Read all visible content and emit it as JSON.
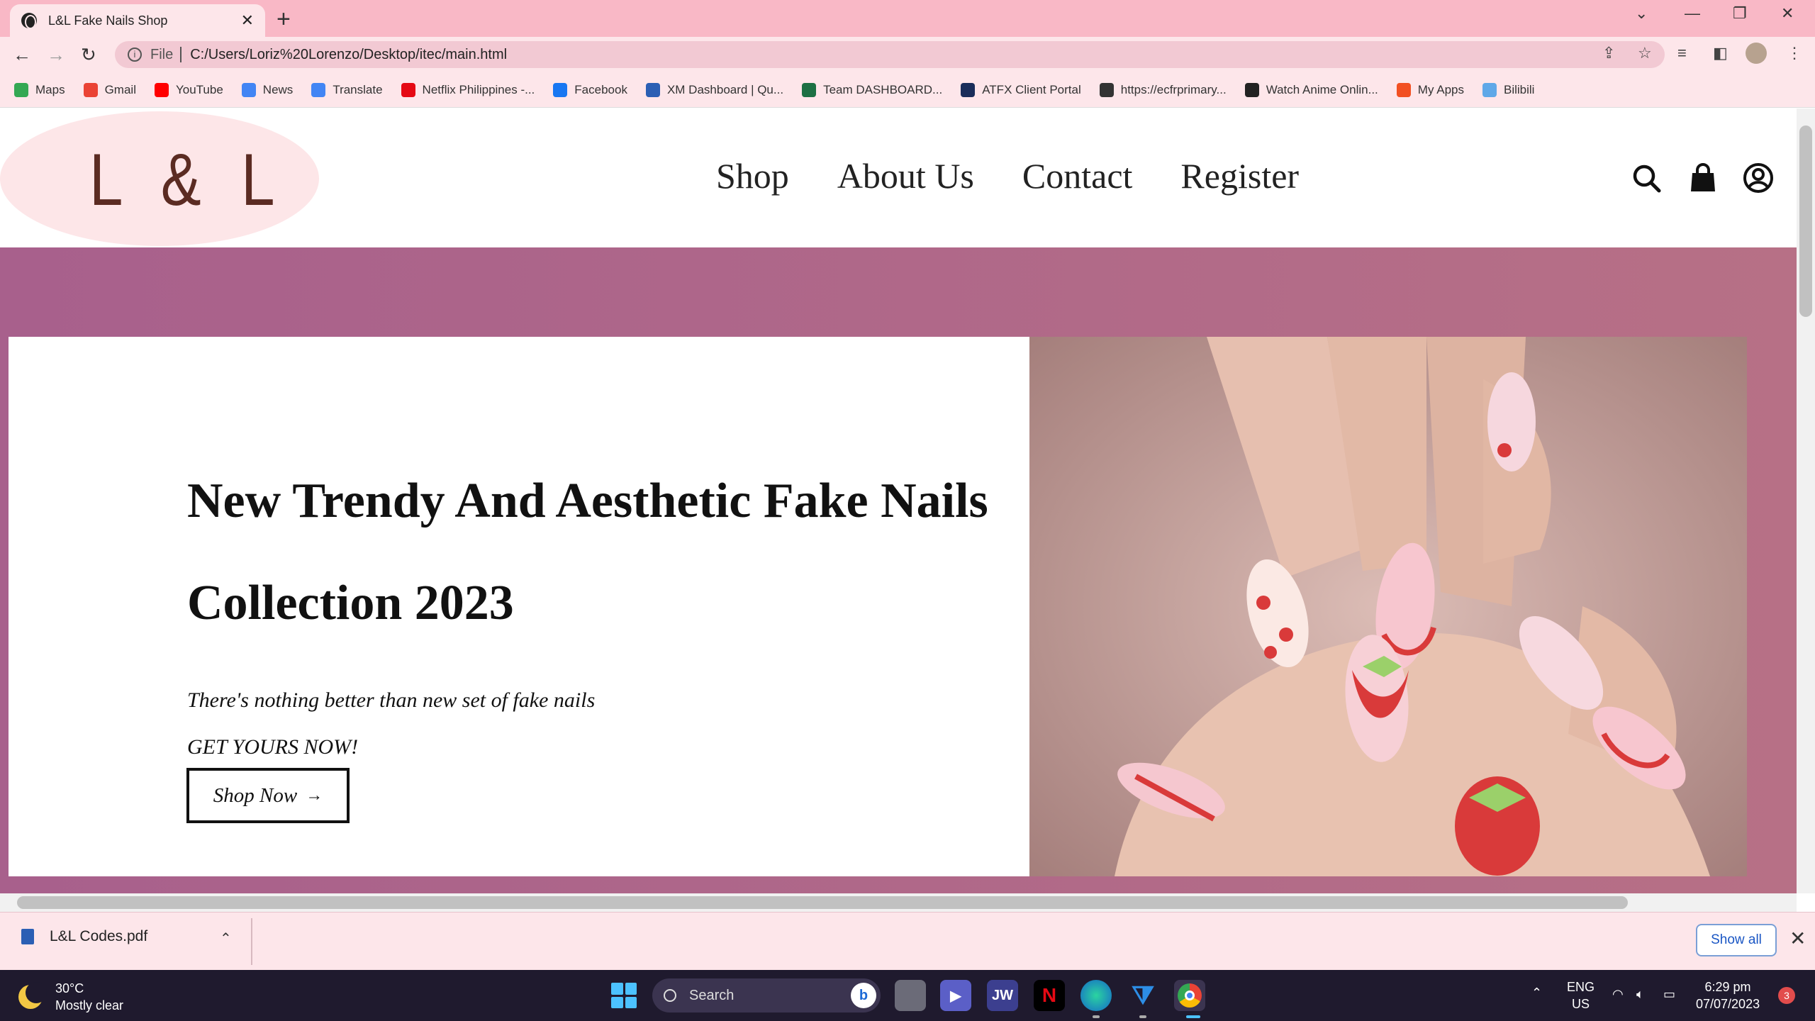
{
  "browser": {
    "tab_title": "L&L Fake Nails Shop",
    "tab_close": "✕",
    "new_tab": "+",
    "address_scheme": "File",
    "address_url": "C:/Users/Loriz%20Lorenzo/Desktop/itec/main.html",
    "bookmarks": [
      {
        "label": "Maps",
        "icon": "maps-icon",
        "color": "#34a853"
      },
      {
        "label": "Gmail",
        "icon": "gmail-icon",
        "color": "#ea4335"
      },
      {
        "label": "YouTube",
        "icon": "youtube-icon",
        "color": "#ff0000"
      },
      {
        "label": "News",
        "icon": "news-icon",
        "color": "#4285f4"
      },
      {
        "label": "Translate",
        "icon": "translate-icon",
        "color": "#4285f4"
      },
      {
        "label": "Netflix Philippines -...",
        "icon": "netflix-icon",
        "color": "#e50914"
      },
      {
        "label": "Facebook",
        "icon": "facebook-icon",
        "color": "#1877f2"
      },
      {
        "label": "XM Dashboard | Qu...",
        "icon": "xm-icon",
        "color": "#2b5fb4"
      },
      {
        "label": "Team DASHBOARD...",
        "icon": "excel-icon",
        "color": "#1d7044"
      },
      {
        "label": "ATFX Client Portal",
        "icon": "atfx-icon",
        "color": "#1a2d5a"
      },
      {
        "label": "https://ecfrprimary...",
        "icon": "globe-icon",
        "color": "#333333"
      },
      {
        "label": "Watch Anime Onlin...",
        "icon": "anime-icon",
        "color": "#222222"
      },
      {
        "label": "My Apps",
        "icon": "apps-icon",
        "color": "#f25022"
      },
      {
        "label": "Bilibili",
        "icon": "bilibili-icon",
        "color": "#5fa8e8"
      }
    ]
  },
  "site": {
    "logo": "L & L",
    "nav": [
      "Shop",
      "About Us",
      "Contact",
      "Register"
    ],
    "hero": {
      "headline": "New Trendy And Aesthetic Fake Nails Collection 2023",
      "tagline": "There's nothing better than new set of fake nails",
      "cta_text": "GET YOURS NOW!",
      "button": "Shop Now",
      "button_arrow": "→"
    },
    "colors": {
      "band": "#a8608c",
      "logo_bg": "#fde6e8",
      "logo_text": "#5b2b22"
    }
  },
  "downloads": {
    "file": "L&L Codes.pdf",
    "show_all": "Show all",
    "close": "✕"
  },
  "taskbar": {
    "weather_temp": "30°C",
    "weather_desc": "Mostly clear",
    "search_placeholder": "Search",
    "lang_top": "ENG",
    "lang_bottom": "US",
    "time": "6:29 pm",
    "date": "07/07/2023",
    "notifications": "3",
    "apps": [
      "file-explorer-icon",
      "teams-icon",
      "jw-icon",
      "netflix-icon",
      "edge-icon",
      "vscode-icon",
      "chrome-icon"
    ]
  }
}
